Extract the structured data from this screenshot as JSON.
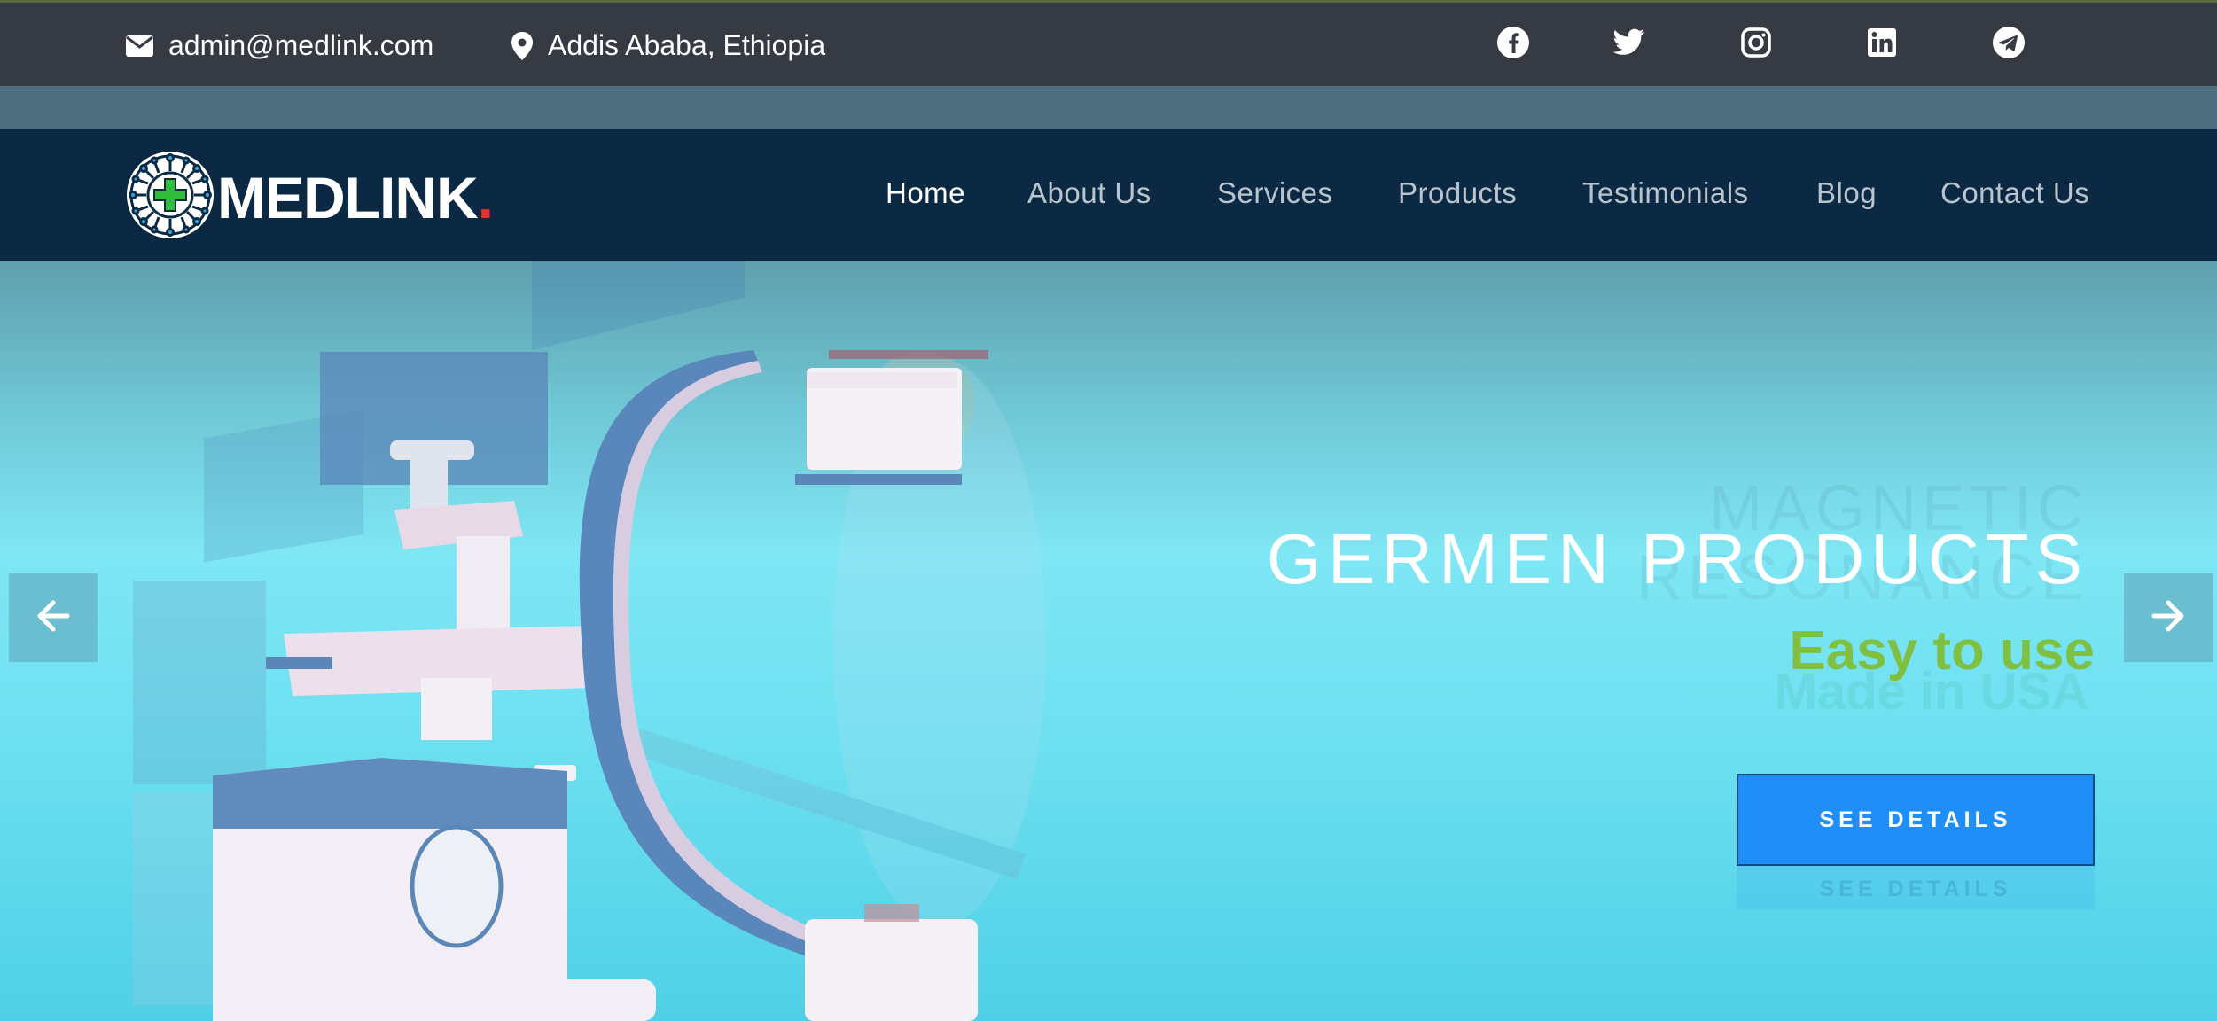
{
  "topbar": {
    "email": "admin@medlink.com",
    "location": "Addis Ababa, Ethiopia",
    "icons": [
      "envelope-icon",
      "map-pin-icon"
    ],
    "social": [
      "facebook-icon",
      "twitter-icon",
      "instagram-icon",
      "linkedin-icon",
      "telegram-icon"
    ]
  },
  "brand": {
    "name": "MEDLINK",
    "dot": ".",
    "colors": {
      "navbar": "#0b2942",
      "accent_dot": "#e63030",
      "logo_cross": "#2fbd3a"
    }
  },
  "nav": {
    "items": [
      {
        "label": "Home",
        "active": true
      },
      {
        "label": "About Us",
        "active": false
      },
      {
        "label": "Services",
        "active": false
      },
      {
        "label": "Products",
        "active": false
      },
      {
        "label": "Testimonials",
        "active": false
      },
      {
        "label": "Blog",
        "active": false
      },
      {
        "label": "Contact Us",
        "active": false
      }
    ]
  },
  "hero": {
    "title": "GERMEN PRODUCTS",
    "subtitle": "Easy to use",
    "ghost_title_line1": "MAGNETIC",
    "ghost_title_line2": "RESONANCE",
    "ghost_subtitle": "Made in USA",
    "cta_label": "SEE DETAILS",
    "colors": {
      "subtitle": "#7fc043",
      "cta": "#1f8ef6"
    },
    "prev_icon": "arrow-left-icon",
    "next_icon": "arrow-right-icon"
  }
}
